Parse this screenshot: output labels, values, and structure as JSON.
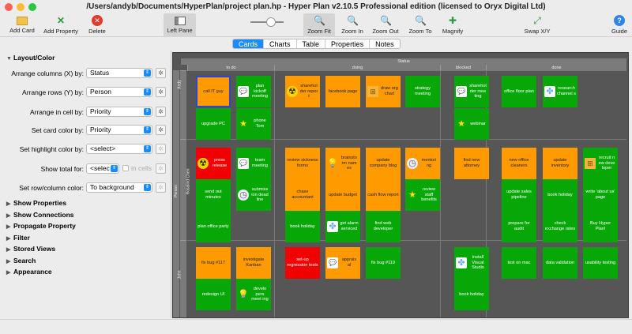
{
  "window": {
    "title": "/Users/andyb/Documents/HyperPlan/project plan.hp - Hyper Plan v2.10.5 Professional edition (licensed to Oryx Digital Ltd)"
  },
  "toolbar": {
    "add_card": "Add Card",
    "add_property": "Add Property",
    "delete": "Delete",
    "left_pane": "Left Pane",
    "zoom_fit": "Zoom Fit",
    "zoom_in": "Zoom In",
    "zoom_out": "Zoom Out",
    "zoom_to": "Zoom To",
    "magnify": "Magnify",
    "swap": "Swap X/Y",
    "guide": "Guide"
  },
  "tabs": [
    "Cards",
    "Charts",
    "Table",
    "Properties",
    "Notes"
  ],
  "left_pane": {
    "layout_color": "Layout/Color",
    "arrange_x_label": "Arrange columns (X) by:",
    "arrange_x_value": "Status",
    "arrange_y_label": "Arrange rows (Y) by:",
    "arrange_y_value": "Person",
    "arrange_cell_label": "Arrange in cell by:",
    "arrange_cell_value": "Priority",
    "card_color_label": "Set card color by:",
    "card_color_value": "Priority",
    "highlight_label": "Set highlight color by:",
    "highlight_value": "<select>",
    "total_label": "Show total for:",
    "total_value": "<selec",
    "in_cells": "in cells",
    "rowcol_color_label": "Set row/column color:",
    "rowcol_color_value": "To background",
    "sections": [
      "Show Properties",
      "Show Connections",
      "Propagate Property",
      "Filter",
      "Stored Views",
      "Search",
      "Appearance"
    ]
  },
  "board": {
    "status_header": "Status",
    "person_header": "Person",
    "columns": [
      "to do",
      "doing",
      "blocked",
      "done"
    ],
    "rows": [
      "Andy",
      "Rosalind Chen",
      "John"
    ],
    "cards": [
      {
        "text": "call IT guy",
        "color": "o",
        "icon": "",
        "selected": true
      },
      {
        "text": "plan kickoff meeting",
        "color": "g",
        "icon": "speech"
      },
      {
        "text": "upgrade PC",
        "color": "g",
        "icon": ""
      },
      {
        "text": "phone Tom",
        "color": "g",
        "icon": "star"
      },
      {
        "text": "sharehol der repor t",
        "color": "o",
        "icon": "radiation"
      },
      {
        "text": "facebook page",
        "color": "o",
        "icon": ""
      },
      {
        "text": "draw org chart",
        "color": "o",
        "icon": "orgchart"
      },
      {
        "text": "strategy meeting",
        "color": "g",
        "icon": ""
      },
      {
        "text": "sharehol der mee ting",
        "color": "g",
        "icon": "speech"
      },
      {
        "text": "webinar",
        "color": "g",
        "icon": "star"
      },
      {
        "text": "office floor plan",
        "color": "g",
        "icon": ""
      },
      {
        "text": "research channel s",
        "color": "g",
        "icon": "puzzle"
      },
      {
        "text": "press release",
        "color": "r",
        "icon": "radiation"
      },
      {
        "text": "team meeting",
        "color": "g",
        "icon": "speech"
      },
      {
        "text": "send out minutes",
        "color": "g",
        "icon": ""
      },
      {
        "text": "submiss ion dead line",
        "color": "g",
        "icon": "clock"
      },
      {
        "text": "plan office party",
        "color": "g",
        "icon": ""
      },
      {
        "text": "review sickness forms",
        "color": "o",
        "icon": ""
      },
      {
        "text": "brainsto rm nam es",
        "color": "o",
        "icon": "bulb"
      },
      {
        "text": "update company blog",
        "color": "o",
        "icon": ""
      },
      {
        "text": "mentori ng",
        "color": "o",
        "icon": "clock"
      },
      {
        "text": "chase accountant",
        "color": "o",
        "icon": ""
      },
      {
        "text": "update budget",
        "color": "o",
        "icon": ""
      },
      {
        "text": "cash flow report",
        "color": "o",
        "icon": ""
      },
      {
        "text": "review staff benefits",
        "color": "g",
        "icon": "star"
      },
      {
        "text": "book holiday",
        "color": "g",
        "icon": ""
      },
      {
        "text": "get alarm serviced",
        "color": "g",
        "icon": "puzzle"
      },
      {
        "text": "find web developer",
        "color": "g",
        "icon": ""
      },
      {
        "text": "find new attorney",
        "color": "o",
        "icon": ""
      },
      {
        "text": "new office cleaners",
        "color": "o",
        "icon": ""
      },
      {
        "text": "update inventory",
        "color": "o",
        "icon": ""
      },
      {
        "text": "recruit n ew deve loper",
        "color": "g",
        "icon": "orgchart"
      },
      {
        "text": "update sales pipeline",
        "color": "g",
        "icon": ""
      },
      {
        "text": "book holiday",
        "color": "g",
        "icon": ""
      },
      {
        "text": "write 'about us' page",
        "color": "g",
        "icon": ""
      },
      {
        "text": "prepare for audit",
        "color": "g",
        "icon": ""
      },
      {
        "text": "check exchange rates",
        "color": "g",
        "icon": ""
      },
      {
        "text": "Buy Hyper Plan!",
        "color": "g",
        "icon": ""
      },
      {
        "text": "fix bug #117",
        "color": "o",
        "icon": ""
      },
      {
        "text": "investigate Kanban",
        "color": "o",
        "icon": ""
      },
      {
        "text": "redesign UI",
        "color": "g",
        "icon": ""
      },
      {
        "text": "develo pers meet ing",
        "color": "g",
        "icon": "bulb"
      },
      {
        "text": "set-up regression tests",
        "color": "r",
        "icon": ""
      },
      {
        "text": "apprais al",
        "color": "o",
        "icon": "speech"
      },
      {
        "text": "fix bug #119",
        "color": "g",
        "icon": ""
      },
      {
        "text": "install Visual Studio",
        "color": "g",
        "icon": "puzzle"
      },
      {
        "text": "book holiday",
        "color": "g",
        "icon": ""
      },
      {
        "text": "test on mac",
        "color": "g",
        "icon": ""
      },
      {
        "text": "data validation",
        "color": "g",
        "icon": ""
      },
      {
        "text": "usability testing",
        "color": "g",
        "icon": ""
      }
    ]
  }
}
